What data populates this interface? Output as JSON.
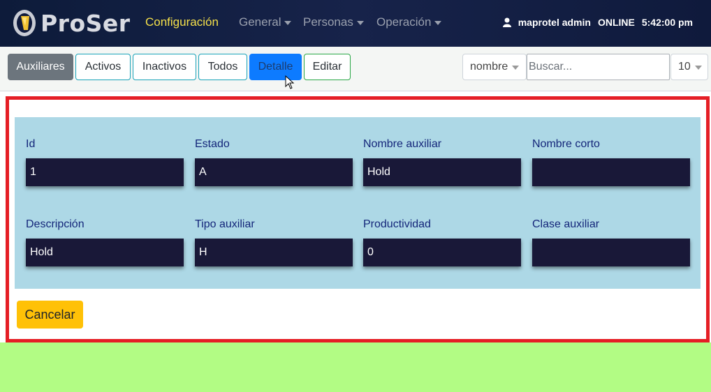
{
  "navbar": {
    "brand": "ProSer",
    "items": [
      {
        "label": "Configuración",
        "active": true
      },
      {
        "label": "General",
        "dropdown": true
      },
      {
        "label": "Personas",
        "dropdown": true
      },
      {
        "label": "Operación",
        "dropdown": true
      }
    ],
    "user": "maprotel admin",
    "status": "ONLINE",
    "time": "5:42:00 pm"
  },
  "toolbar": {
    "buttons": [
      "Auxiliares",
      "Activos",
      "Inactivos",
      "Todos",
      "Detalle",
      "Editar"
    ],
    "sort_field": "nombre",
    "search_placeholder": "Buscar...",
    "page_size": "10"
  },
  "form": {
    "fields": [
      {
        "label": "Id",
        "value": "1"
      },
      {
        "label": "Estado",
        "value": "A"
      },
      {
        "label": "Nombre auxiliar",
        "value": "Hold"
      },
      {
        "label": "Nombre corto",
        "value": ""
      },
      {
        "label": "Descripción",
        "value": "Hold"
      },
      {
        "label": "Tipo auxiliar",
        "value": "H"
      },
      {
        "label": "Productividad",
        "value": "0"
      },
      {
        "label": "Clase auxiliar",
        "value": ""
      }
    ],
    "cancel_label": "Cancelar"
  },
  "colors": {
    "navbar_bg": "#17234a",
    "active_nav": "#f5e04a",
    "form_bg": "#add8e6",
    "field_bg": "#191838",
    "frame_border": "#e51e25",
    "cancel_bg": "#ffc107",
    "page_bottom": "#b2fc84"
  }
}
